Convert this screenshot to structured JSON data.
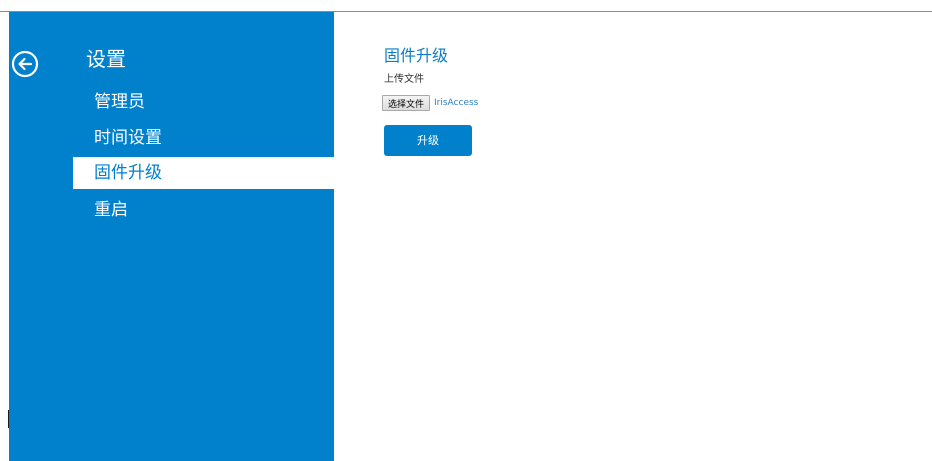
{
  "sidebar": {
    "title": "设置",
    "back_icon": "arrow-left-circle-icon",
    "items": [
      {
        "label": "管理员",
        "active": false
      },
      {
        "label": "时间设置",
        "active": false
      },
      {
        "label": "固件升级",
        "active": true
      },
      {
        "label": "重启",
        "active": false
      }
    ]
  },
  "main": {
    "title": "固件升级",
    "upload_label": "上传文件",
    "file_button_label": "选择文件",
    "file_name": "IrisAccess",
    "upgrade_button_label": "升级"
  },
  "colors": {
    "sidebar_bg": "#0180cc",
    "accent": "#0d7cc2",
    "active_item_bg": "#ffffff"
  }
}
